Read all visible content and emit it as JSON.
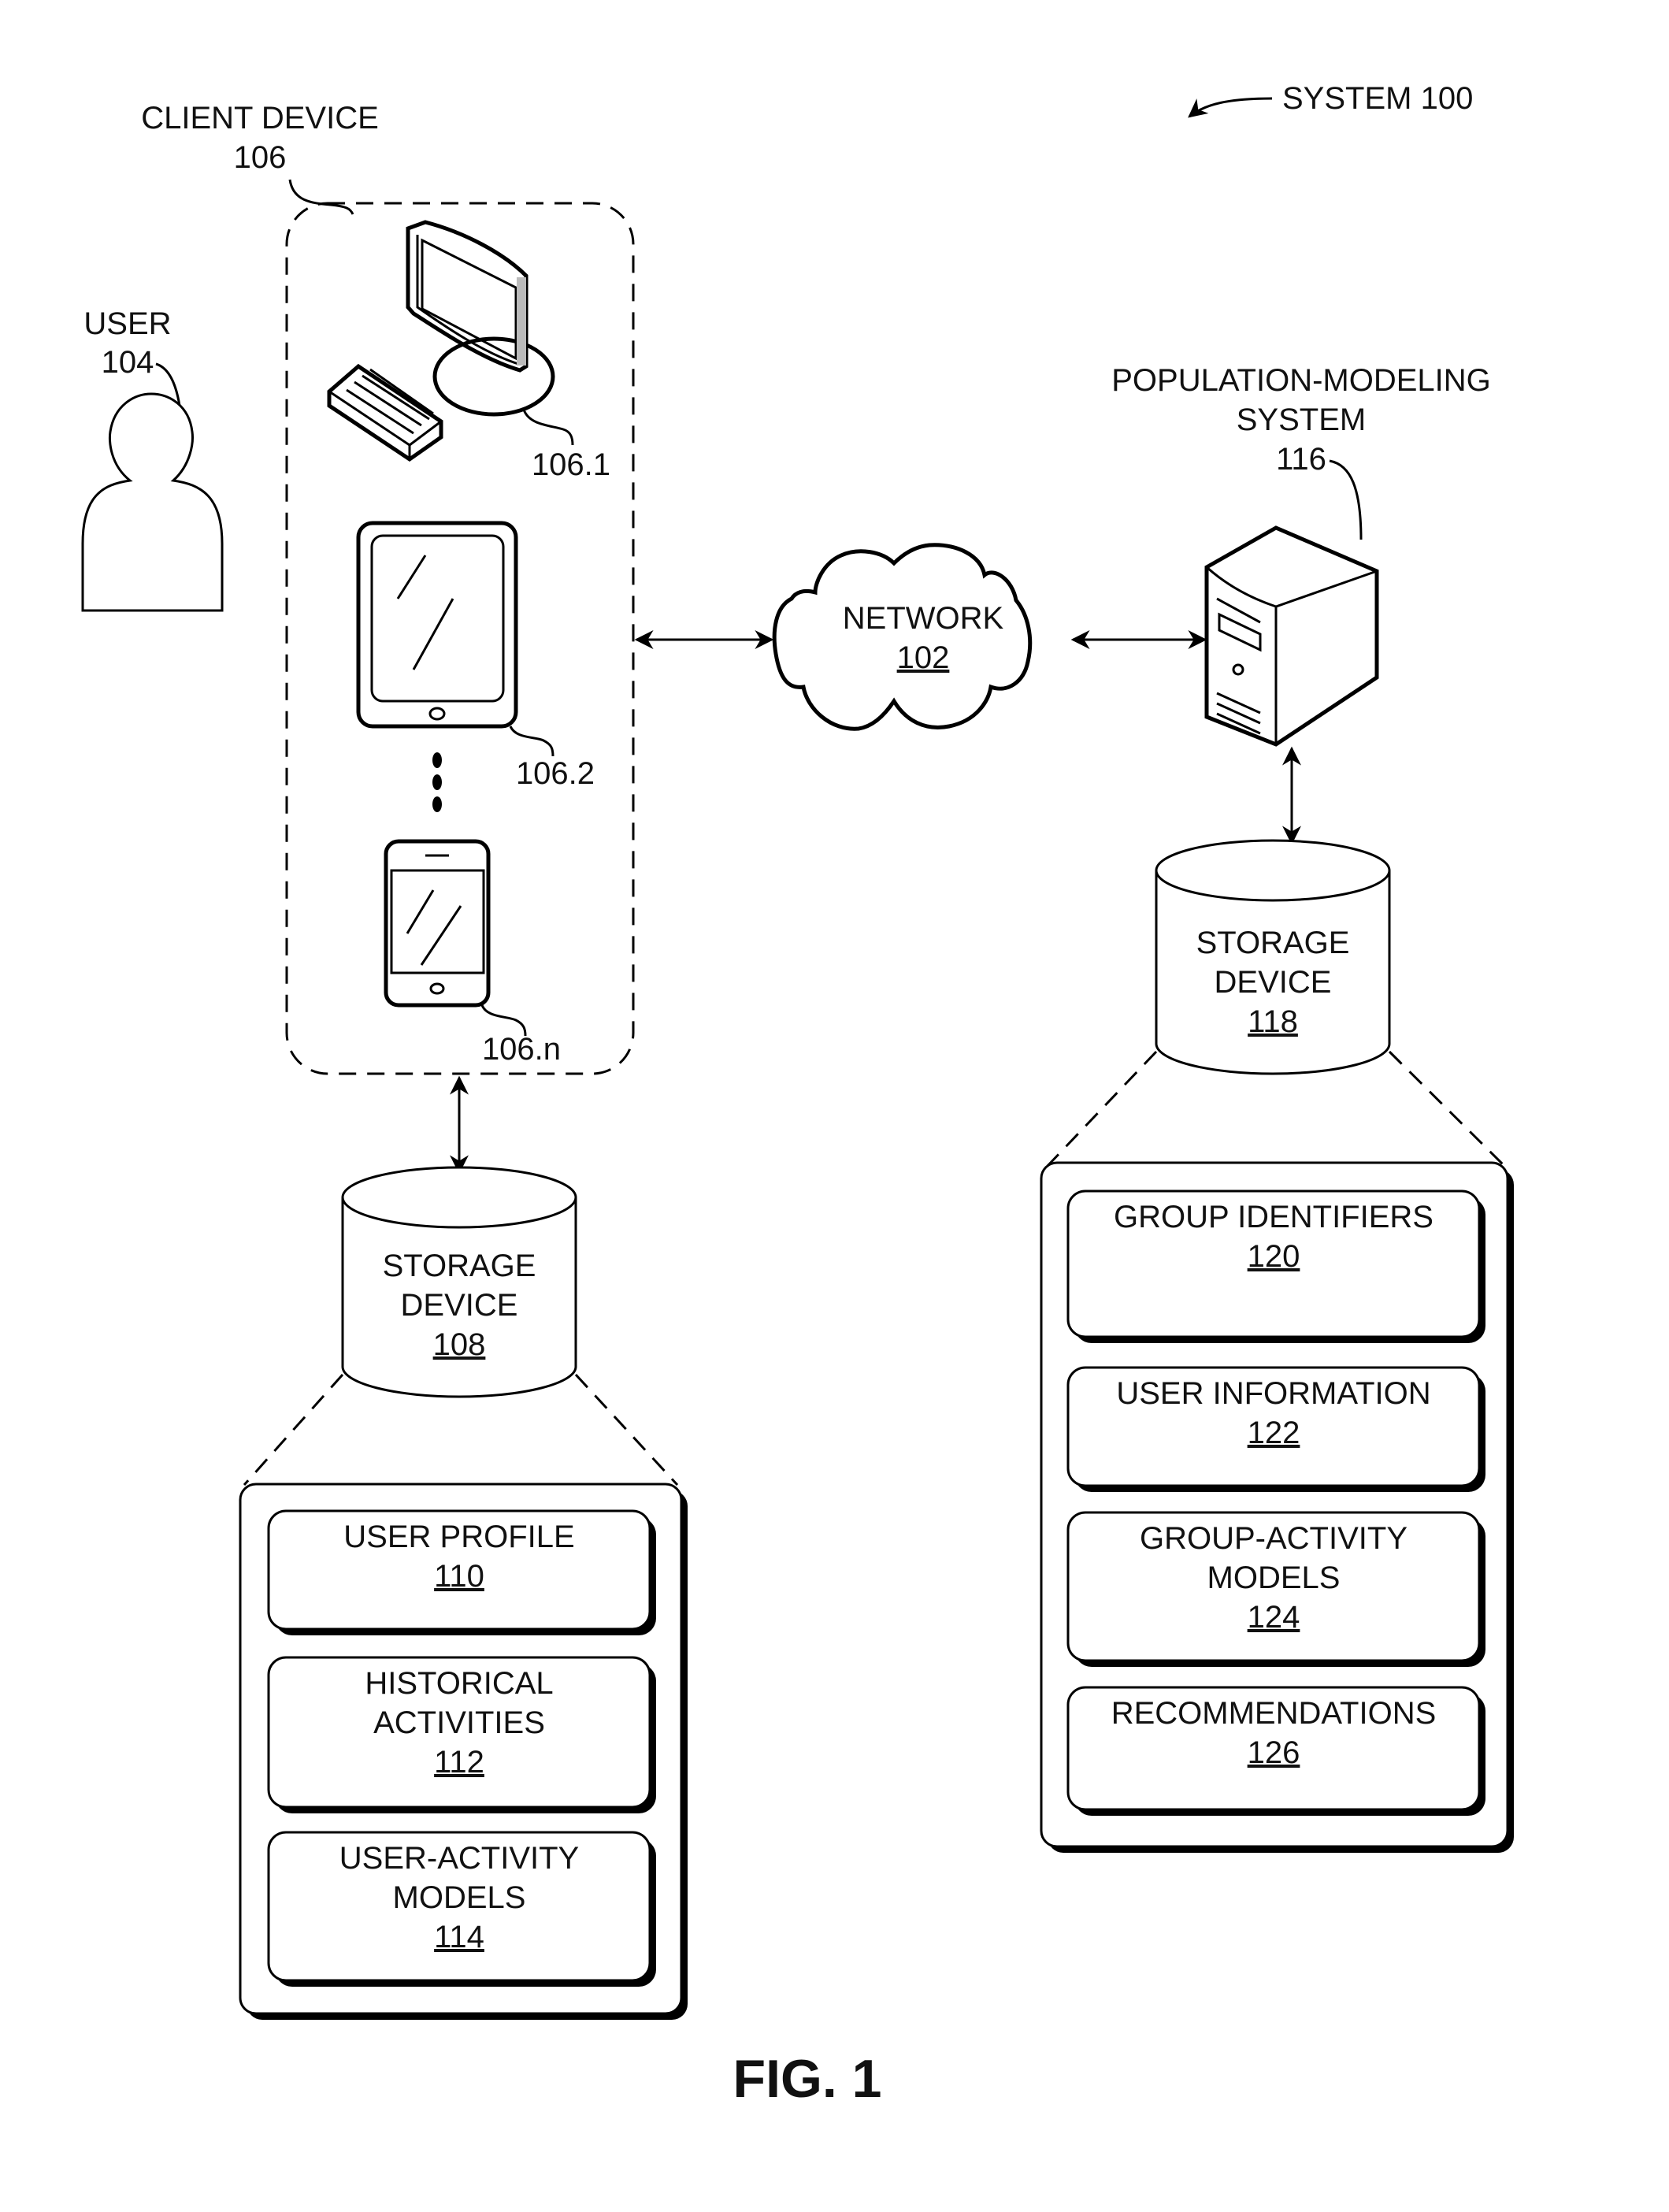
{
  "figure": {
    "system_label": "SYSTEM 100",
    "caption": "FIG. 1"
  },
  "user": {
    "label": "USER",
    "ref": "104"
  },
  "client_device": {
    "label": "CLIENT DEVICE",
    "ref": "106",
    "devices": [
      {
        "type": "desktop-computer",
        "ref": "106.1"
      },
      {
        "type": "tablet",
        "ref": "106.2"
      },
      {
        "type": "smartphone",
        "ref": "106.n"
      }
    ]
  },
  "network": {
    "label": "NETWORK",
    "ref": "102"
  },
  "population_modeling_system": {
    "label_line1": "POPULATION-MODELING",
    "label_line2": "SYSTEM",
    "ref": "116"
  },
  "storage_left": {
    "label_line1": "STORAGE",
    "label_line2": "DEVICE",
    "ref": "108",
    "items": [
      {
        "lines": [
          "USER PROFILE"
        ],
        "ref": "110"
      },
      {
        "lines": [
          "HISTORICAL",
          "ACTIVITIES"
        ],
        "ref": "112"
      },
      {
        "lines": [
          "USER-ACTIVITY",
          "MODELS"
        ],
        "ref": "114"
      }
    ]
  },
  "storage_right": {
    "label_line1": "STORAGE",
    "label_line2": "DEVICE",
    "ref": "118",
    "items": [
      {
        "lines": [
          "GROUP IDENTIFIERS"
        ],
        "ref": "120"
      },
      {
        "lines": [
          "USER INFORMATION"
        ],
        "ref": "122"
      },
      {
        "lines": [
          "GROUP-ACTIVITY",
          "MODELS"
        ],
        "ref": "124"
      },
      {
        "lines": [
          "RECOMMENDATIONS"
        ],
        "ref": "126"
      }
    ]
  }
}
